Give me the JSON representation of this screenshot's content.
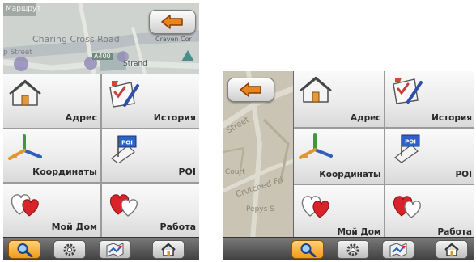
{
  "portrait": {
    "map": {
      "labels": [
        "Маршрут",
        "Charing Cross Road",
        "p Street",
        "A400",
        "Strand",
        "Craven Cor"
      ]
    },
    "menu": [
      {
        "label": "Адрес",
        "icon": "house-icon"
      },
      {
        "label": "История",
        "icon": "history-checklist-icon"
      },
      {
        "label": "Координаты",
        "icon": "coordinates-axes-icon"
      },
      {
        "label": "POI",
        "icon": "poi-flag-icon"
      },
      {
        "label": "Мой Дом",
        "icon": "home-hearts-icon"
      },
      {
        "label": "Работа",
        "icon": "work-hearts-icon"
      }
    ]
  },
  "landscape": {
    "map": {
      "labels": [
        "Street",
        "Court",
        "Crutched Fri",
        "Pepys S"
      ]
    },
    "menu": [
      {
        "label": "Адрес",
        "icon": "house-icon"
      },
      {
        "label": "История",
        "icon": "history-checklist-icon"
      },
      {
        "label": "Координаты",
        "icon": "coordinates-axes-icon"
      },
      {
        "label": "POI",
        "icon": "poi-flag-icon"
      },
      {
        "label": "Мой Дом",
        "icon": "home-hearts-icon"
      },
      {
        "label": "Работа",
        "icon": "work-hearts-icon"
      }
    ]
  },
  "poi_badge": "POI",
  "toolbar": [
    "search-icon",
    "settings-gear-icon",
    "route-map-icon",
    "home-icon"
  ],
  "colors": {
    "active_button": "#f29a16",
    "back_arrow": "#e8861e",
    "heart_red": "#d8232a",
    "poi_blue": "#2b63c9"
  }
}
